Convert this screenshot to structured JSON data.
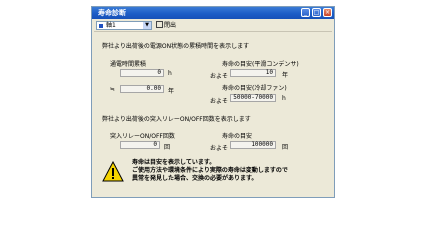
{
  "window": {
    "title": "寿命診断"
  },
  "toolbar": {
    "combo_value": "軸1",
    "close_label": "閉出"
  },
  "section1": {
    "heading": "弊社より出荷後の電源ON状態の累積時間を表示します",
    "cumulative_label": "通電時間累積",
    "cumulative_value": "0",
    "cumulative_unit": "h",
    "approx_symbol": "≒",
    "cumulative_years": "0.00",
    "years_unit": "年",
    "capacitor_label": "寿命の目安(平滑コンデンサ)",
    "about1": "およそ",
    "capacitor_value": "10",
    "capacitor_unit": "年",
    "fan_label": "寿命の目安(冷却ファン)",
    "about2": "およそ",
    "fan_value": "50000-70000",
    "fan_unit": "h"
  },
  "section2": {
    "heading": "弊社より出荷後の突入リレーON/OFF回数を表示します",
    "relay_label": "突入リレーON/OFF回数",
    "relay_value": "0",
    "relay_unit": "回",
    "life_label": "寿命の目安",
    "about": "およそ",
    "life_value": "100000",
    "life_unit": "回"
  },
  "notice": {
    "line1": "寿命は目安を表示しています。",
    "line2": "ご使用方法や環境条件により実際の寿命は変動しますので",
    "line3": "異常を発見した場合、交換の必要があります。"
  }
}
